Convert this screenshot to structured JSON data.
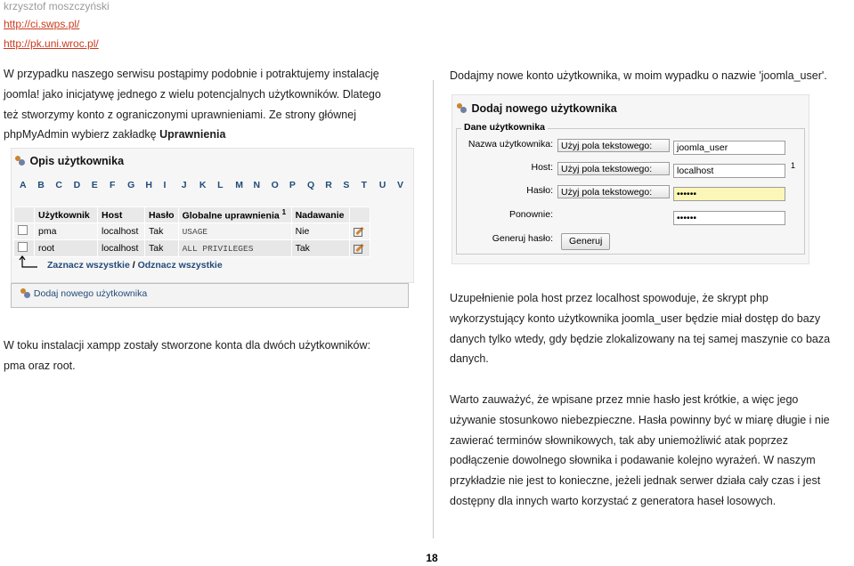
{
  "header": {
    "author": "krzysztof moszczyński",
    "links": [
      "http://ci.swps.pl/",
      "http://pk.uni.wroc.pl/"
    ]
  },
  "left": {
    "para1": [
      "W przypadku naszego serwisu postąpimy podobnie i potraktujemy instalację",
      "joomla! jako inicjatywę jednego z wielu potencjalnych użytkowników. Dlatego",
      "też stworzymy konto z ograniczonymi uprawnieniami. Ze strony głównej"
    ],
    "para1_last_prefix": "phpMyAdmin wybierz zakładkę ",
    "para1_last_bold": "Uprawnienia",
    "para2": [
      "W toku instalacji xampp zostały stworzone konta dla dwóch użytkowników:",
      "pma oraz root."
    ]
  },
  "users_shot": {
    "title": "Opis użytkownika",
    "letters": [
      "A",
      "B",
      "C",
      "D",
      "E",
      "F",
      "G",
      "H",
      "I",
      "J",
      "K",
      "L",
      "M",
      "N",
      "O",
      "P",
      "Q",
      "R",
      "S",
      "T",
      "U",
      "V"
    ],
    "columns": [
      "Użytkownik",
      "Host",
      "Hasło",
      "Globalne uprawnienia",
      "Nadawanie"
    ],
    "global_sup": "1",
    "rows": [
      {
        "user": "pma",
        "host": "localhost",
        "password": "Tak",
        "privileges": "USAGE",
        "grant": "Nie"
      },
      {
        "user": "root",
        "host": "localhost",
        "password": "Tak",
        "privileges": "ALL PRIVILEGES",
        "grant": "Tak"
      }
    ],
    "check_all": "Zaznacz wszystkie",
    "separator": "/",
    "uncheck_all": "Odznacz wszystkie"
  },
  "add_user_bar": {
    "label": "Dodaj nowego użytkownika"
  },
  "right": {
    "para1": "Dodajmy nowe konto użytkownika, w moim wypadku o nazwie 'joomla_user'.",
    "para2": [
      "Uzupełnienie pola host przez localhost spowoduje, że skrypt php",
      "wykorzystujący konto użytkownika joomla_user będzie miał dostęp do bazy",
      "danych tylko wtedy, gdy będzie zlokalizowany na tej samej maszynie co baza",
      "danych."
    ],
    "para3": [
      "Warto zauważyć, że wpisane przez mnie hasło jest krótkie, a więc jego",
      "używanie stosunkowo niebezpieczne. Hasła powinny być w miarę długie i nie",
      "zawierać terminów słownikowych, tak aby uniemożliwić atak poprzez",
      "podłączenie dowolnego słownika i podawanie kolejno wyrażeń. W naszym",
      "przykładzie nie jest to konieczne, jeżeli jednak serwer działa cały czas i jest",
      "dostępny dla innych warto korzystać z generatora haseł losowych."
    ]
  },
  "add_shot": {
    "title": "Dodaj nowego użytkownika",
    "legend": "Dane użytkownika",
    "username_label": "Nazwa użytkownika:",
    "username_select": "Użyj pola tekstowego:",
    "username_value": "joomla_user",
    "host_label": "Host:",
    "host_select": "Użyj pola tekstowego:",
    "host_value": "localhost",
    "host_sup": "1",
    "password_label": "Hasło:",
    "password_select": "Użyj pola tekstowego:",
    "password_value": "••••••",
    "retype_label": "Ponownie:",
    "retype_value": "••••••",
    "generate_label": "Generuj hasło:",
    "generate_button": "Generuj"
  },
  "page_number": "18"
}
